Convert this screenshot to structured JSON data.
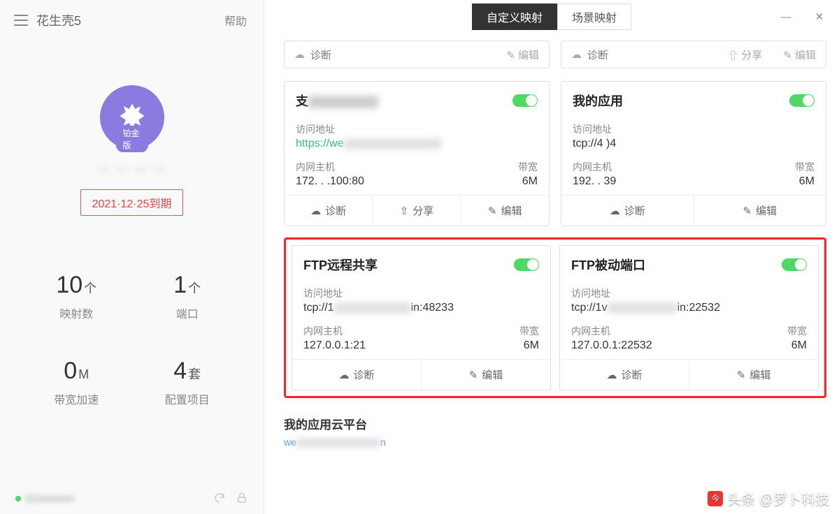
{
  "sidebar": {
    "app_name": "花生壳5",
    "help": "帮助",
    "tier_badge": "铂金版",
    "username": "— — — —",
    "expire": "2021·12·25到期",
    "stats": [
      {
        "num": "10",
        "unit": "个",
        "label": "映射数"
      },
      {
        "num": "1",
        "unit": "个",
        "label": "端口"
      },
      {
        "num": "0",
        "unit": "M",
        "label": "带宽加速"
      },
      {
        "num": "4",
        "unit": "套",
        "label": "配置项目"
      }
    ],
    "status_sn": "11xxxxxxxx"
  },
  "header": {
    "tabs": [
      "自定义映射",
      "场景映射"
    ],
    "active_tab": 0
  },
  "stub_row": {
    "diag": "诊断",
    "edit": "编辑",
    "share": "分享"
  },
  "cards": [
    {
      "title_prefix": "支",
      "title_hidden": true,
      "on": true,
      "addr_label": "访问地址",
      "addr": "https://we",
      "addr_link": true,
      "host_label": "内网主机",
      "host": "172. . .100:80",
      "bw_label": "带宽",
      "bw": "6M",
      "foot": [
        "诊断",
        "分享",
        "编辑"
      ]
    },
    {
      "title": "我的应用",
      "on": true,
      "addr_label": "访问地址",
      "addr": "tcp://4              )4",
      "host_label": "内网主机",
      "host": "192. .      39",
      "bw_label": "带宽",
      "bw": "6M",
      "foot": [
        "诊断",
        "编辑"
      ]
    }
  ],
  "ftp_cards": [
    {
      "title": "FTP远程共享",
      "on": true,
      "addr_label": "访问地址",
      "addr_pre": "tcp://1",
      "addr_suf": "in:48233",
      "host_label": "内网主机",
      "host": "127.0.0.1:21",
      "bw_label": "带宽",
      "bw": "6M",
      "foot": [
        "诊断",
        "编辑"
      ]
    },
    {
      "title": "FTP被动端口",
      "on": true,
      "addr_label": "访问地址",
      "addr_pre": "tcp://1v",
      "addr_suf": "in:22532",
      "host_label": "内网主机",
      "host": "127.0.0.1:22532",
      "bw_label": "带宽",
      "bw": "6M",
      "foot": [
        "诊断",
        "编辑"
      ]
    }
  ],
  "cloud": {
    "title": "我的应用云平台",
    "url_prefix": "we",
    "url_suffix": "n"
  },
  "watermark": "头条 @罗卜科技",
  "icons": {
    "diag": "✧",
    "share": "⇪",
    "edit": "✎",
    "minimize": "—",
    "close": "✕",
    "lock": "🔒",
    "refresh": "↻"
  }
}
